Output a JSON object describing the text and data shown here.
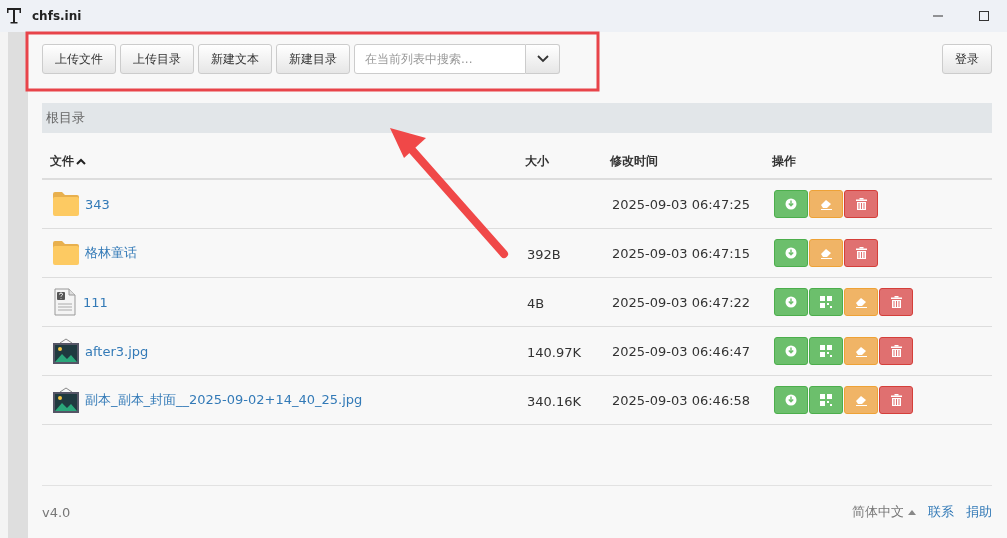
{
  "window": {
    "title": "chfs.ini"
  },
  "toolbar": {
    "buttons": [
      "上传文件",
      "上传目录",
      "新建文本",
      "新建目录"
    ],
    "search": {
      "placeholder": "在当前列表中搜索..."
    },
    "login": "登录"
  },
  "breadcrumb": "根目录",
  "table": {
    "columns": [
      {
        "label": "文件",
        "sorted": true
      },
      {
        "label": "大小",
        "sorted": false
      },
      {
        "label": "修改时间",
        "sorted": false
      },
      {
        "label": "操作",
        "sorted": false
      }
    ],
    "rows": [
      {
        "kind": "folder",
        "name": "343",
        "time": "2025-09-03 06:47:25",
        "actions": [
          {
            "kind": "download"
          },
          {
            "kind": "rename"
          },
          {
            "kind": "delete"
          }
        ]
      },
      {
        "kind": "folder",
        "name": "格林童话",
        "size": "392B",
        "time": "2025-09-03 06:47:15",
        "actions": [
          {
            "kind": "download"
          },
          {
            "kind": "rename"
          },
          {
            "kind": "delete"
          }
        ]
      },
      {
        "kind": "unknown",
        "name": "111",
        "size": "4B",
        "time": "2025-09-03 06:47:22",
        "actions": [
          {
            "kind": "download"
          },
          {
            "kind": "qrcode"
          },
          {
            "kind": "rename"
          },
          {
            "kind": "delete"
          }
        ]
      },
      {
        "kind": "image",
        "name": "after3.jpg",
        "size": "140.97K",
        "time": "2025-09-03 06:46:47",
        "actions": [
          {
            "kind": "download"
          },
          {
            "kind": "qrcode"
          },
          {
            "kind": "rename"
          },
          {
            "kind": "delete"
          }
        ]
      },
      {
        "kind": "image",
        "name": "副本_副本_封面__2025-09-02+14_40_25.jpg",
        "size": "340.16K",
        "time": "2025-09-03 06:46:58",
        "actions": [
          {
            "kind": "download"
          },
          {
            "kind": "qrcode"
          },
          {
            "kind": "rename"
          },
          {
            "kind": "delete"
          }
        ]
      }
    ]
  },
  "footer": {
    "version": "v4.0",
    "language": "简体中文",
    "links": [
      "联系",
      "捐助"
    ]
  }
}
